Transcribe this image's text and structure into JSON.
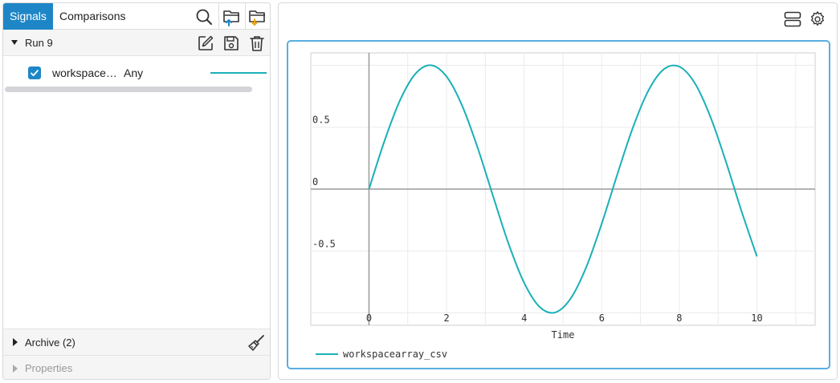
{
  "tabs": {
    "signals": "Signals",
    "comparisons": "Comparisons"
  },
  "toolbar_icons": [
    "search-icon",
    "folder-upload-icon",
    "folder-download-icon"
  ],
  "run": {
    "label": "Run 9",
    "icons": [
      "edit-icon",
      "save-icon",
      "trash-icon"
    ]
  },
  "signal": {
    "name": "workspace…",
    "type": "Any",
    "checked": true,
    "color": "#1ab0b8"
  },
  "archive": {
    "label": "Archive (2)",
    "icon": "broom-icon"
  },
  "properties": {
    "label": "Properties"
  },
  "plot_icons": [
    "layout-icon",
    "settings-icon"
  ],
  "colors": {
    "accent": "#1e86c6",
    "series": "#1ab0b8",
    "frame": "#5aaee0"
  },
  "chart_data": {
    "type": "line",
    "xlabel": "Time",
    "ylabel": "",
    "xlim": [
      -1.5,
      11.5
    ],
    "ylim": [
      -1.1,
      1.1
    ],
    "xticks": [
      0,
      2,
      4,
      6,
      8,
      10
    ],
    "xtick_labels": [
      "0",
      "2",
      "4",
      "6",
      "8",
      "10"
    ],
    "yticks": [
      -0.5,
      0,
      0.5
    ],
    "ytick_labels": [
      "-0.5",
      "0",
      "0.5"
    ],
    "grid": true,
    "legend": "bottom-left",
    "series": [
      {
        "name": "workspacearray_csv",
        "color": "#1ab0b8",
        "x": [
          0,
          0.4,
          0.8,
          1.2,
          1.6,
          2.0,
          2.4,
          2.8,
          3.2,
          3.6,
          4.0,
          4.4,
          4.8,
          5.2,
          5.6,
          6.0,
          6.4,
          6.8,
          7.2,
          7.6,
          8.0,
          8.4,
          8.8,
          9.2,
          9.6,
          10.0
        ],
        "y": [
          0,
          0.389,
          0.717,
          0.932,
          1.0,
          0.909,
          0.675,
          0.335,
          -0.058,
          -0.443,
          -0.757,
          -0.952,
          -0.996,
          -0.883,
          -0.631,
          -0.279,
          0.117,
          0.494,
          0.794,
          0.968,
          0.989,
          0.855,
          0.585,
          0.223,
          -0.175,
          -0.544
        ]
      }
    ]
  }
}
